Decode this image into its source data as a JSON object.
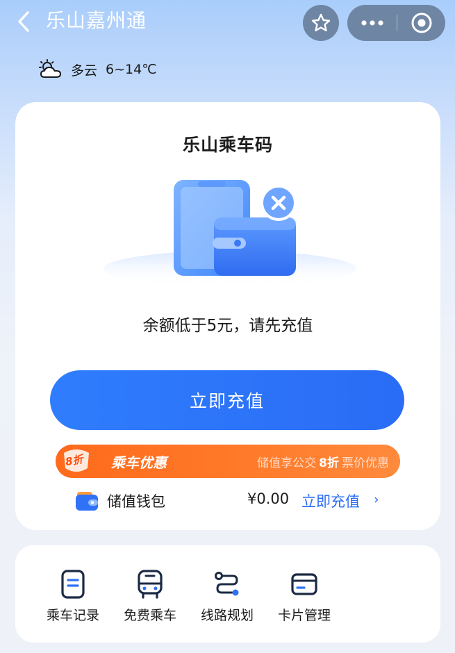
{
  "header": {
    "title": "乐山嘉州通",
    "back_icon": "chevron-left-icon",
    "favorite_icon": "star-icon",
    "more_icon": "more-dots-icon",
    "close_icon": "target-close-icon"
  },
  "weather": {
    "icon": "cloudy-icon",
    "description": "多云",
    "temperature": "6~14℃"
  },
  "card": {
    "title": "乐山乘车码",
    "illustration": "wallet-phone-error-icon",
    "message": "余额低于5元，请先充值",
    "recharge_button": "立即充值"
  },
  "promo": {
    "badge": "8折",
    "title": "乘车优惠",
    "desc_prefix": "储值享公交",
    "desc_discount": "8折",
    "desc_suffix": "票价优惠"
  },
  "wallet": {
    "icon": "wallet-icon",
    "label": "储值钱包",
    "amount": "¥0.00",
    "link": "立即充值",
    "arrow": "›"
  },
  "menu": [
    {
      "label": "乘车记录",
      "icon": "ride-record-icon"
    },
    {
      "label": "免费乘车",
      "icon": "bus-icon"
    },
    {
      "label": "线路规划",
      "icon": "route-icon"
    },
    {
      "label": "卡片管理",
      "icon": "card-icon"
    }
  ],
  "colors": {
    "accent": "#2a6cf5",
    "promo": "#ff6a1c",
    "header_button": "#6e86a3"
  }
}
